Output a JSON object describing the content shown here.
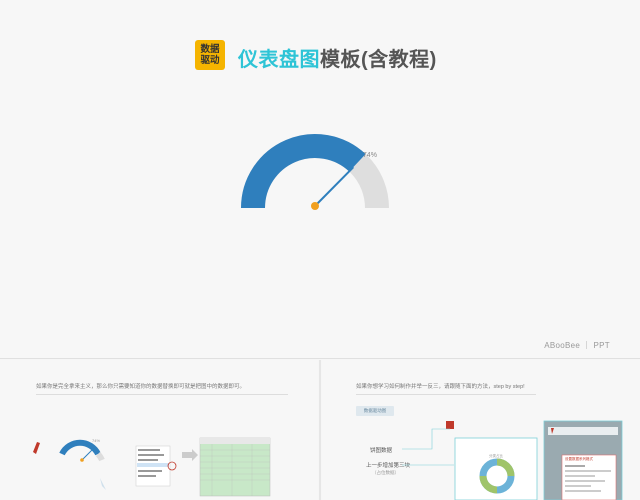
{
  "header": {
    "badge_line1": "数据",
    "badge_line2": "驱动",
    "title_accent": "仪表盘图",
    "title_rest": "模板(含教程)"
  },
  "gauge": {
    "value_label": "74%",
    "value": 0.74,
    "colors": {
      "filled": "#2f7fbd",
      "track": "#dedede",
      "needle": "#2f7fbd",
      "pivot": "#f0a020"
    }
  },
  "footer": {
    "brand": "ABooBee ｜ PPT"
  },
  "panel_left": {
    "instruction": "如果你是完全拿来主义，那么你只需要知道你的数据替换即可就是把图中的数据即可。",
    "mini_value": "74%"
  },
  "panel_right": {
    "instruction": "如果你想学习如何制作并举一反三，请跟随下面的方法，step by step!",
    "tag": "数据驱动图",
    "callout_1": "饼图数据",
    "callout_2": "上一步增加第三块",
    "callout_2_sub": "（占位数据）",
    "chart_label": "分类占比",
    "dialog_title": "设置数据系列格式"
  }
}
